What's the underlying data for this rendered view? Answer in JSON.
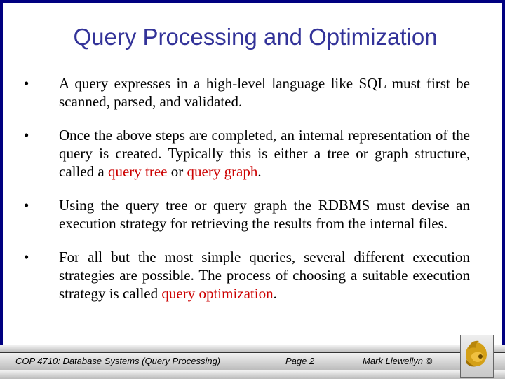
{
  "slide": {
    "title": "Query Processing and Optimization",
    "bullets": [
      {
        "marker": "•",
        "segments": [
          {
            "text": "A query expresses in a high-level language like SQL must first be scanned, parsed, and validated.",
            "highlight": false
          }
        ]
      },
      {
        "marker": "•",
        "segments": [
          {
            "text": "Once the above steps are completed, an internal representation of the query is created.  Typically this is either a tree or graph structure, called a ",
            "highlight": false
          },
          {
            "text": "query tree",
            "highlight": true
          },
          {
            "text": " or ",
            "highlight": false
          },
          {
            "text": "query graph",
            "highlight": true
          },
          {
            "text": ".",
            "highlight": false
          }
        ]
      },
      {
        "marker": "•",
        "segments": [
          {
            "text": "Using the query tree or query graph the RDBMS must devise an execution strategy for retrieving the results from the internal files.",
            "highlight": false
          }
        ]
      },
      {
        "marker": "•",
        "segments": [
          {
            "text": "For all but the most simple queries, several different execution strategies are possible.  The process of choosing a suitable execution strategy is called ",
            "highlight": false
          },
          {
            "text": "query optimization",
            "highlight": true
          },
          {
            "text": ".",
            "highlight": false
          }
        ]
      }
    ]
  },
  "footer": {
    "course": "COP 4710: Database Systems (Query Processing)",
    "page": "Page 2",
    "author": "Mark Llewellyn ©",
    "logo_icon": "pegasus-logo-icon"
  },
  "colors": {
    "title": "#333399",
    "highlight": "#cc0000",
    "border": "#000080",
    "logo_gold": "#d4a017"
  }
}
